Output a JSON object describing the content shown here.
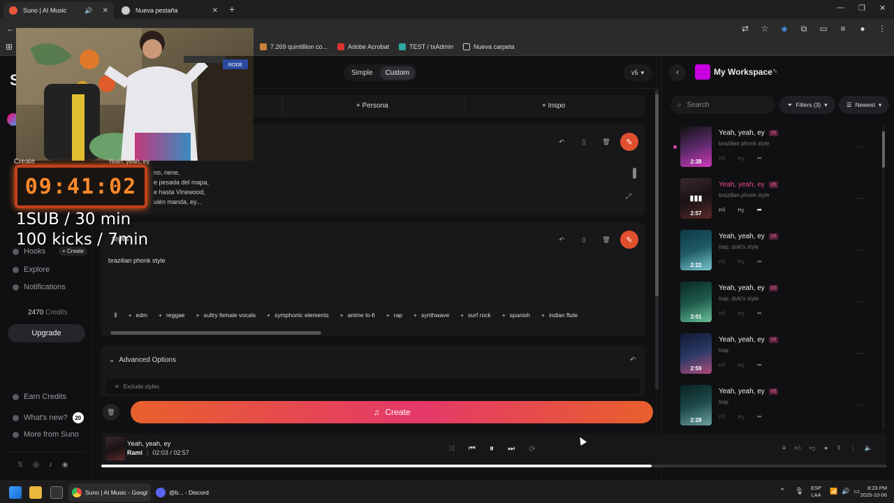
{
  "browser": {
    "tabs": [
      {
        "label": "Suno | AI Music"
      },
      {
        "label": "Nueva pestaña"
      }
    ],
    "bookmarks": [
      "7.269 quintillion co...",
      "Adobe Acrobat",
      "TEST / txAdmin",
      "Nueva carpeta"
    ]
  },
  "overlay": {
    "timer": "09:41:02",
    "line1": "1SUB / 30 min",
    "line2": "100 kicks / 7min",
    "cam_fragments": {
      "create": "Create",
      "lyrics": "Yeah, yeah, ey",
      "style": "Styles"
    }
  },
  "sidebar": {
    "logo": "S",
    "items": [
      {
        "label": "Hooks"
      },
      {
        "label": "Explore"
      },
      {
        "label": "Notifications"
      }
    ],
    "hooks_create": "+ Create",
    "credits_value": "2470",
    "credits_label": "Credits",
    "upgrade": "Upgrade",
    "earn": "Earn Credits",
    "whats_new": "What's new?",
    "whats_new_count": "20",
    "more": "More from Suno"
  },
  "main": {
    "mode_simple": "Simple",
    "mode_custom": "Custom",
    "version": "v5",
    "persona": "+ Persona",
    "inspo": "+ Inspo",
    "lyrics_lines": [
      "no, nene,",
      "e pesada del mapa,",
      "e hasta Vinewood,",
      "uién manda, ey..."
    ],
    "style_text": "brazilian phonk style",
    "style_chips": [
      "edm",
      "reggae",
      "sultry female vocals",
      "symphonic elements",
      "anime lo-fi",
      "rap",
      "synthwave",
      "surf rock",
      "spanish",
      "indian flute"
    ],
    "advanced": "Advanced Options",
    "exclude": "Exclude styles",
    "create": "Create"
  },
  "workspace": {
    "title": "My Workspace",
    "search_placeholder": "Search",
    "filters": "Filters (3)",
    "sort": "Newest",
    "songs": [
      {
        "title": "Yeah, yeah, ey",
        "badge": "v5",
        "desc": "brazilian phonk style",
        "duration": "2:38",
        "thumb": "#5a2a6a"
      },
      {
        "title": "Yeah, yeah, ey",
        "badge": "v5",
        "desc": "brazilian phonk style",
        "duration": "2:57",
        "thumb": "#3a2a2e"
      },
      {
        "title": "Yeah, yeah, ey",
        "badge": "v5",
        "desc": "trap, duki's style",
        "duration": "2:22",
        "thumb": "#1f5a66"
      },
      {
        "title": "Yeah, yeah, ey",
        "badge": "v5",
        "desc": "trap, duki's style",
        "duration": "3:01",
        "thumb": "#1e5a4a"
      },
      {
        "title": "Yeah, yeah, ey",
        "badge": "v5",
        "desc": "trap",
        "duration": "2:59",
        "thumb": "#2a3a66"
      },
      {
        "title": "Yeah, yeah, ey",
        "badge": "v5",
        "desc": "trap",
        "duration": "2:28",
        "thumb": "#1e4a4a"
      }
    ]
  },
  "player": {
    "title": "Yeah, yeah, ey",
    "artist": "Rami",
    "time": "02:03 / 02:57",
    "progress": 0.7
  },
  "taskbar": {
    "chrome": "Suno | AI Music - Googl",
    "discord": "@b... - Discord",
    "lang1": "ESP",
    "lang2": "LAA",
    "time": "8:23 PM",
    "date": "2025-10-06"
  }
}
